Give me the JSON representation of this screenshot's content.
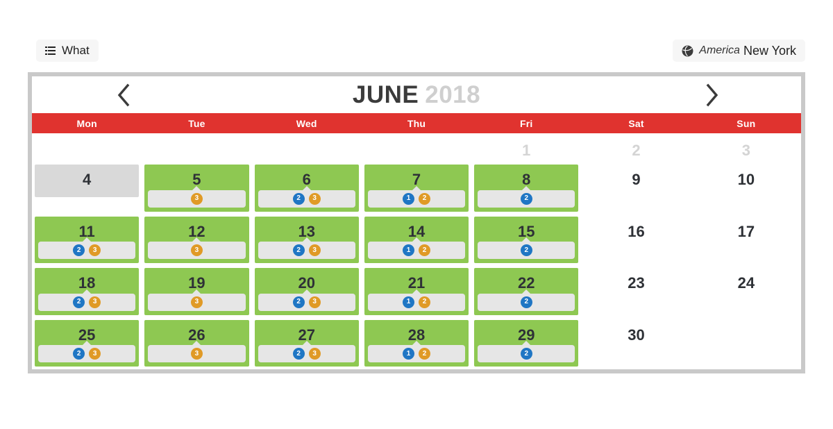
{
  "toolbar": {
    "what_label": "What",
    "what_icon": "list-icon",
    "timezone_icon": "globe-icon",
    "timezone_area": "America",
    "timezone_city": "New York"
  },
  "calendar": {
    "prev_icon": "chevron-left-icon",
    "next_icon": "chevron-right-icon",
    "month": "JUNE",
    "year": "2018",
    "weekdays": [
      "Mon",
      "Tue",
      "Wed",
      "Thu",
      "Fri",
      "Sat",
      "Sun"
    ],
    "colors": {
      "header_red": "#e0332f",
      "available_green": "#8ec852",
      "today_gray": "#d9d9d9",
      "badge_blue": "#1f76c4",
      "badge_orange": "#e09a26",
      "badge_strip": "#e6e6e6",
      "frame_gray": "#c9c9c9",
      "muted_text": "#d4d4d4"
    },
    "weeks": [
      [
        {
          "day": "",
          "state": "empty",
          "badges": []
        },
        {
          "day": "",
          "state": "empty",
          "badges": []
        },
        {
          "day": "",
          "state": "empty",
          "badges": []
        },
        {
          "day": "",
          "state": "empty",
          "badges": []
        },
        {
          "day": "1",
          "state": "muted",
          "badges": []
        },
        {
          "day": "2",
          "state": "muted",
          "badges": []
        },
        {
          "day": "3",
          "state": "muted",
          "badges": []
        }
      ],
      [
        {
          "day": "4",
          "state": "today",
          "badges": []
        },
        {
          "day": "5",
          "state": "available",
          "badges": [
            {
              "color": "orange",
              "count": "3"
            }
          ]
        },
        {
          "day": "6",
          "state": "available",
          "badges": [
            {
              "color": "blue",
              "count": "2"
            },
            {
              "color": "orange",
              "count": "3"
            }
          ]
        },
        {
          "day": "7",
          "state": "available",
          "badges": [
            {
              "color": "blue",
              "count": "1"
            },
            {
              "color": "orange",
              "count": "2"
            }
          ]
        },
        {
          "day": "8",
          "state": "available",
          "badges": [
            {
              "color": "blue",
              "count": "2"
            }
          ]
        },
        {
          "day": "9",
          "state": "plain",
          "badges": []
        },
        {
          "day": "10",
          "state": "plain",
          "badges": []
        }
      ],
      [
        {
          "day": "11",
          "state": "available",
          "badges": [
            {
              "color": "blue",
              "count": "2"
            },
            {
              "color": "orange",
              "count": "3"
            }
          ]
        },
        {
          "day": "12",
          "state": "available",
          "badges": [
            {
              "color": "orange",
              "count": "3"
            }
          ]
        },
        {
          "day": "13",
          "state": "available",
          "badges": [
            {
              "color": "blue",
              "count": "2"
            },
            {
              "color": "orange",
              "count": "3"
            }
          ]
        },
        {
          "day": "14",
          "state": "available",
          "badges": [
            {
              "color": "blue",
              "count": "1"
            },
            {
              "color": "orange",
              "count": "2"
            }
          ]
        },
        {
          "day": "15",
          "state": "available",
          "badges": [
            {
              "color": "blue",
              "count": "2"
            }
          ]
        },
        {
          "day": "16",
          "state": "plain",
          "badges": []
        },
        {
          "day": "17",
          "state": "plain",
          "badges": []
        }
      ],
      [
        {
          "day": "18",
          "state": "available",
          "badges": [
            {
              "color": "blue",
              "count": "2"
            },
            {
              "color": "orange",
              "count": "3"
            }
          ]
        },
        {
          "day": "19",
          "state": "available",
          "badges": [
            {
              "color": "orange",
              "count": "3"
            }
          ]
        },
        {
          "day": "20",
          "state": "available",
          "badges": [
            {
              "color": "blue",
              "count": "2"
            },
            {
              "color": "orange",
              "count": "3"
            }
          ]
        },
        {
          "day": "21",
          "state": "available",
          "badges": [
            {
              "color": "blue",
              "count": "1"
            },
            {
              "color": "orange",
              "count": "2"
            }
          ]
        },
        {
          "day": "22",
          "state": "available",
          "badges": [
            {
              "color": "blue",
              "count": "2"
            }
          ]
        },
        {
          "day": "23",
          "state": "plain",
          "badges": []
        },
        {
          "day": "24",
          "state": "plain",
          "badges": []
        }
      ],
      [
        {
          "day": "25",
          "state": "available",
          "badges": [
            {
              "color": "blue",
              "count": "2"
            },
            {
              "color": "orange",
              "count": "3"
            }
          ]
        },
        {
          "day": "26",
          "state": "available",
          "badges": [
            {
              "color": "orange",
              "count": "3"
            }
          ]
        },
        {
          "day": "27",
          "state": "available",
          "badges": [
            {
              "color": "blue",
              "count": "2"
            },
            {
              "color": "orange",
              "count": "3"
            }
          ]
        },
        {
          "day": "28",
          "state": "available",
          "badges": [
            {
              "color": "blue",
              "count": "1"
            },
            {
              "color": "orange",
              "count": "2"
            }
          ]
        },
        {
          "day": "29",
          "state": "available",
          "badges": [
            {
              "color": "blue",
              "count": "2"
            }
          ]
        },
        {
          "day": "30",
          "state": "plain",
          "badges": []
        },
        {
          "day": "",
          "state": "empty",
          "badges": []
        }
      ]
    ]
  }
}
